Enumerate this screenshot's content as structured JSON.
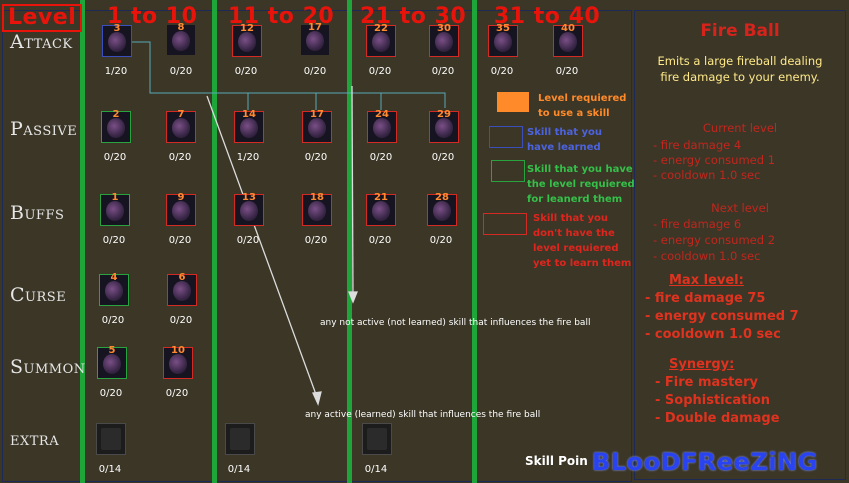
{
  "header": {
    "level": "Level",
    "ranges": [
      "1 to 10",
      "11 to 20",
      "21 to 30",
      "31 to 40"
    ]
  },
  "rows": [
    "Attack",
    "Passive",
    "Buffs",
    "Curse",
    "Summon",
    "extra"
  ],
  "skills": {
    "attack": [
      {
        "num": "3",
        "count": "1/20",
        "frame": "blue"
      },
      {
        "num": "8",
        "count": "0/20",
        "frame": "none"
      },
      {
        "num": "12",
        "count": "0/20",
        "frame": "red"
      },
      {
        "num": "17",
        "count": "0/20",
        "frame": "none"
      },
      {
        "num": "22",
        "count": "0/20",
        "frame": "red"
      },
      {
        "num": "30",
        "count": "0/20",
        "frame": "red"
      },
      {
        "num": "35",
        "count": "0/20",
        "frame": "red"
      },
      {
        "num": "40",
        "count": "0/20",
        "frame": "red"
      }
    ],
    "passive": [
      {
        "num": "2",
        "count": "0/20",
        "frame": "green"
      },
      {
        "num": "7",
        "count": "0/20",
        "frame": "red"
      },
      {
        "num": "14",
        "count": "1/20",
        "frame": "red"
      },
      {
        "num": "17",
        "count": "0/20",
        "frame": "red"
      },
      {
        "num": "24",
        "count": "0/20",
        "frame": "red"
      },
      {
        "num": "29",
        "count": "0/20",
        "frame": "red"
      }
    ],
    "buffs": [
      {
        "num": "1",
        "count": "0/20",
        "frame": "green"
      },
      {
        "num": "9",
        "count": "0/20",
        "frame": "red"
      },
      {
        "num": "13",
        "count": "0/20",
        "frame": "red"
      },
      {
        "num": "18",
        "count": "0/20",
        "frame": "red"
      },
      {
        "num": "21",
        "count": "0/20",
        "frame": "red"
      },
      {
        "num": "28",
        "count": "0/20",
        "frame": "red"
      }
    ],
    "curse": [
      {
        "num": "4",
        "count": "0/20",
        "frame": "green"
      },
      {
        "num": "6",
        "count": "0/20",
        "frame": "red"
      }
    ],
    "summon": [
      {
        "num": "5",
        "count": "0/20",
        "frame": "green"
      },
      {
        "num": "10",
        "count": "0/20",
        "frame": "red"
      }
    ],
    "extra": [
      {
        "count": "0/14"
      },
      {
        "count": "0/14"
      },
      {
        "count": "0/14"
      }
    ]
  },
  "legend": {
    "level_required": "Level requiered to use a skill",
    "learned": "Skill that you have learned",
    "have_level": "Skill that you have the level requiered for leanerd them",
    "no_level": "Skill that you don't have the level requiered yet to learn them",
    "colors": {
      "orange": "#ff8a2a",
      "blue": "#3a4fbc",
      "green": "#29a33e",
      "red": "#d42a24"
    }
  },
  "notes": {
    "not_active": "any not active (not learned) skill that influences the fire ball",
    "active": "any active (learned) skill that influences the fire ball"
  },
  "side_panel": {
    "title": "Fire Ball",
    "description": "Emits a large fireball dealing fire damage to your enemy.",
    "current_level": {
      "heading": "Current level",
      "lines": [
        "- fire damage 4",
        "- energy consumed 1",
        "- cooldown 1.0 sec"
      ]
    },
    "next_level": {
      "heading": "Next level",
      "lines": [
        "- fire damage 6",
        "- energy consumed 2",
        "- cooldown 1.0 sec"
      ]
    },
    "max_level": {
      "heading": "Max level:",
      "lines": [
        "- fire damage 75",
        "- energy consumed 7",
        "- cooldown 1.0 sec"
      ]
    },
    "synergy": {
      "heading": "Synergy:",
      "lines": [
        "- Fire mastery",
        "- Sophistication",
        "- Double damage"
      ]
    }
  },
  "footer": {
    "skill_points": "Skill Poin",
    "signature": "BLooDFReeZiNG"
  }
}
